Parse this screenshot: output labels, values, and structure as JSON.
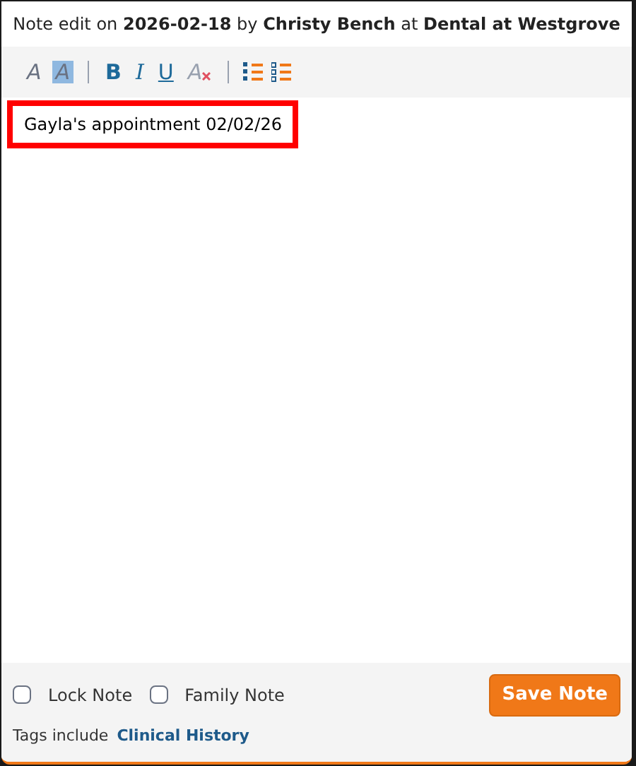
{
  "header": "Note edit on **2026-02-18** by **Christy Bench** at **Dental at Westgrove**",
  "toolbar": [
    {
      "kind": "font-color",
      "label": "A"
    },
    {
      "kind": "highlight",
      "label": "A"
    },
    {
      "kind": "separator"
    },
    {
      "kind": "bold",
      "label": "B"
    },
    {
      "kind": "italic",
      "label": "I"
    },
    {
      "kind": "underline",
      "label": "U"
    },
    {
      "kind": "clear-format",
      "label": "A"
    },
    {
      "kind": "separator"
    },
    {
      "kind": "ordered-list"
    },
    {
      "kind": "bullet-list"
    }
  ],
  "note": {
    "text": "Gayla's appointment 02/02/26",
    "highlighted": true
  },
  "options": [
    {
      "label": "Lock Note",
      "checked": false
    },
    {
      "label": "Family Note",
      "checked": false
    }
  ],
  "save_button": "Save Note",
  "tags": {
    "label": "Tags include",
    "link": "Clinical History"
  }
}
